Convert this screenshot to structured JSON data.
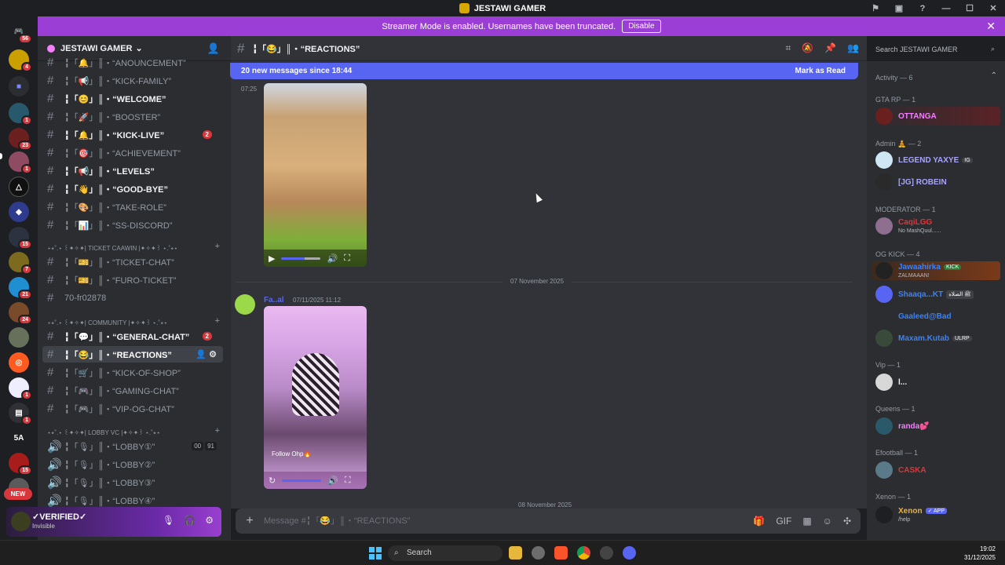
{
  "window": {
    "title": "JESTAWI GAMER",
    "controls": [
      "—",
      "☐",
      "✕"
    ]
  },
  "banner": {
    "text": "Streamer Mode is enabled. Usernames have been truncated.",
    "button": "Disable"
  },
  "rail": {
    "badges": [
      "56",
      "4",
      "1",
      "23",
      "1",
      "15",
      "7",
      "21",
      "24",
      "1",
      "1",
      "15"
    ],
    "text_server": "5A",
    "new_label": "NEW"
  },
  "server": {
    "name": "JESTAWI GAMER"
  },
  "channels": [
    {
      "name": "╏「🔔」║・“ANOUNCEMENT”",
      "state": "normal"
    },
    {
      "name": "╏「📢」║・“KICK-FAMILY”",
      "state": "normal"
    },
    {
      "name": "╏「😊」║・“WELCOME”",
      "state": "unread"
    },
    {
      "name": "╏「🚀」║・“BOOSTER”",
      "state": "normal"
    },
    {
      "name": "╏「🔔」║・“KICK-LIVE”",
      "state": "unread",
      "count": "2"
    },
    {
      "name": "╏「🎯」║・“ACHIEVEMENT”",
      "state": "normal"
    },
    {
      "name": "╏「📢」║・“LEVELS”",
      "state": "unread"
    },
    {
      "name": "╏「👋」║・“GOOD-BYE”",
      "state": "unread"
    },
    {
      "name": "╏「🎨」║・“TAKE-ROLE”",
      "state": "normal"
    },
    {
      "name": "╏「📊」║・“SS-DISCORD”",
      "state": "normal"
    }
  ],
  "categories": {
    "ticket": "⋆⭒˚.⋆ ꒰✦✧✦| TICKET CAAWIN |✦✧✦꒱ ⋆.˚⭒⋆",
    "community": "⋆⭒˚.⋆ ꒰✦✧✦| COMMUNITY |✦✧✦꒱ ⋆.˚⭒⋆",
    "lobby": "⋆⭒˚.⋆ ꒰✦✧✦| LOBBY VC |✦✧✦꒱ ⋆.˚⭒⋆"
  },
  "ticket_channels": [
    {
      "name": "╏「🎫」║・“TICKET-CHAT”",
      "state": "normal"
    },
    {
      "name": "╏「🎫」║・“FURO-TICKET”",
      "state": "normal"
    },
    {
      "name": "70-fr02878",
      "state": "normal"
    }
  ],
  "community_channels": [
    {
      "name": "╏「💬」║・“GENERAL-CHAT”",
      "state": "unread",
      "count": "2"
    },
    {
      "name": "╏「😂」║・“REACTIONS”",
      "state": "active"
    },
    {
      "name": "╏「🛒」║・“KICK-OF-SHOP”",
      "state": "normal"
    },
    {
      "name": "╏「🎮」║・“GAMING-CHAT”",
      "state": "normal"
    },
    {
      "name": "╏「🎮」║・“VIP-OG-CHAT”",
      "state": "normal"
    }
  ],
  "voice_channels": [
    {
      "name": "╏「🎙」║・“LOBBY①”",
      "vc": [
        "00",
        "91"
      ]
    },
    {
      "name": "╏「🎙」║・“LOBBY②”"
    },
    {
      "name": "╏「🎙」║・“LOBBY③”"
    },
    {
      "name": "╏「🎙」║・“LOBBY④”"
    }
  ],
  "user": {
    "name": "✓VERIFIED✓",
    "status": "Invisible"
  },
  "chat": {
    "title": "╏「😂」║・“REACTIONS”",
    "new_messages": "20 new messages since 18:44",
    "mark_read": "Mark as Read",
    "first_time": "07:25",
    "date_divider": "07 November 2025",
    "msg_author": "Fa..al",
    "msg_time": "07/11/2025 11:12",
    "video_caption": "Follow Ohp🔥",
    "next_divider": "08 November 2025",
    "composer_placeholder": "Message #╏「😂」║・“REACTIONS”"
  },
  "search": {
    "placeholder": "Search JESTAWI GAMER"
  },
  "members": {
    "activity": "Activity — 6",
    "groups": [
      {
        "header": "GTA RP — 1",
        "members": [
          {
            "name": "OTTANGA",
            "color": "#f47fff"
          }
        ]
      },
      {
        "header": "Admin 🧘 — 2",
        "members": [
          {
            "name": "LEGEND YAXYE",
            "color": "#a8a4ff",
            "tag": "IG"
          },
          {
            "name": "[JG] ROBEIN",
            "color": "#a8a4ff"
          }
        ]
      },
      {
        "header": "MODERATOR — 1",
        "members": [
          {
            "name": "CaqiLGG",
            "color": "#da373c",
            "sub": "No MashQuul......"
          }
        ]
      },
      {
        "header": "OG KICK — 4",
        "members": [
          {
            "name": "Jawaahirka",
            "color": "#3b82f6",
            "tag": "KICK",
            "sub": "ZALMAAAN!"
          },
          {
            "name": "Shaaqa...KT",
            "color": "#3b82f6",
            "tag": "ﷺ الصلاه"
          },
          {
            "name": "Gaaleed@Bad",
            "color": "#3b82f6"
          },
          {
            "name": "Maxam.Kutab",
            "color": "#3b82f6",
            "tag": "ULRP"
          }
        ]
      },
      {
        "header": "Vip — 1",
        "members": [
          {
            "name": "l...",
            "color": "#f2f3f5"
          }
        ]
      },
      {
        "header": "Queens — 1",
        "members": [
          {
            "name": "randa💕",
            "color": "#f47fff"
          }
        ]
      },
      {
        "header": "Efootball — 1",
        "members": [
          {
            "name": "CASKA",
            "color": "#da373c"
          }
        ]
      },
      {
        "header": "Xenon — 1",
        "members": [
          {
            "name": "Xenon",
            "color": "#f0b232",
            "tag": "✓ APP",
            "sub": "/help"
          }
        ]
      }
    ]
  },
  "taskbar": {
    "search": "Search",
    "time": "19:02",
    "date": "31/12/2025"
  }
}
